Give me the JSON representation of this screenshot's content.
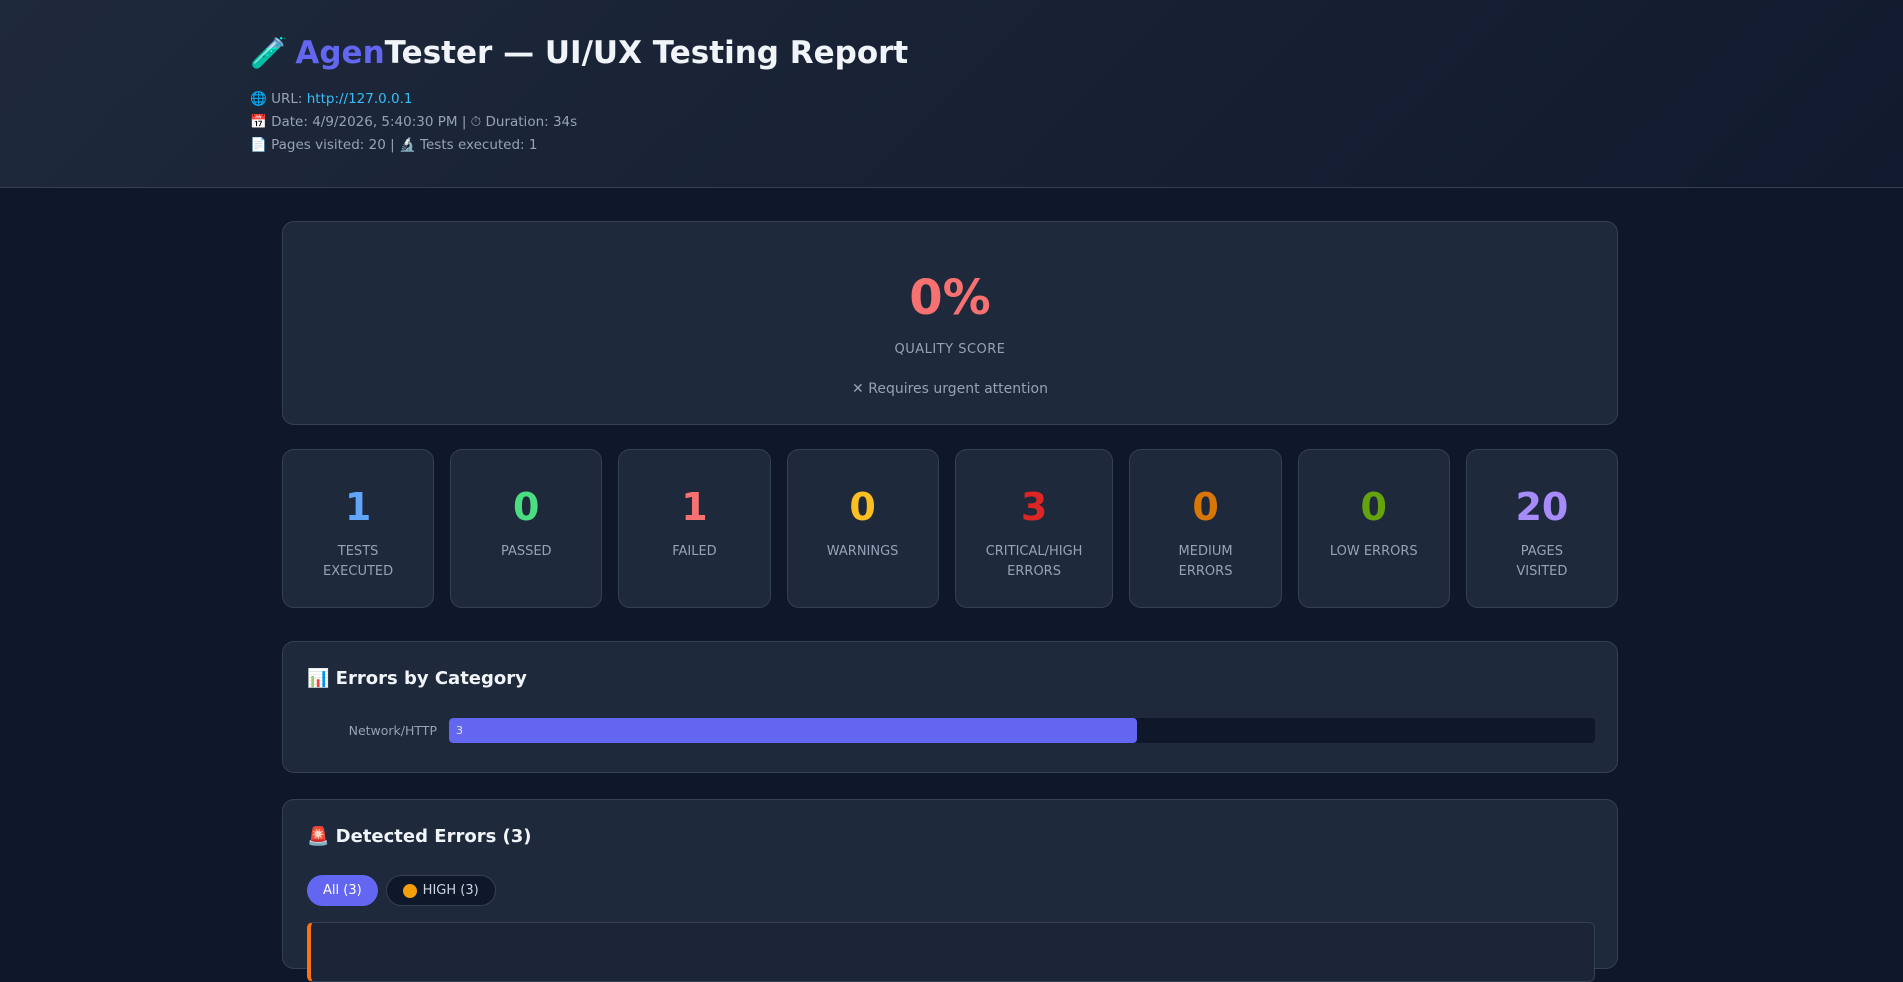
{
  "header": {
    "title_icon": "🧪",
    "title_accent": "Agen",
    "title_rest": "Tester — UI/UX Testing Report",
    "url_prefix": "🌐 URL: ",
    "url": "http://127.0.0.1",
    "date_line": "📅 Date: 4/9/2026, 5:40:30 PM | ⏱ Duration: 34s",
    "pages_line": "📄 Pages visited: 20 | 🔬 Tests executed: 1"
  },
  "score": {
    "value": "0%",
    "label": "QUALITY SCORE",
    "note": "✕ Requires urgent attention"
  },
  "stats": [
    {
      "value": "1",
      "label": "Tests executed",
      "color": "#60a5fa"
    },
    {
      "value": "0",
      "label": "Passed",
      "color": "#4ade80"
    },
    {
      "value": "1",
      "label": "Failed",
      "color": "#f87171"
    },
    {
      "value": "0",
      "label": "Warnings",
      "color": "#fbbf24"
    },
    {
      "value": "3",
      "label": "Critical/High errors",
      "color": "#dc2626"
    },
    {
      "value": "0",
      "label": "Medium errors",
      "color": "#d97706"
    },
    {
      "value": "0",
      "label": "Low errors",
      "color": "#65a30d"
    },
    {
      "value": "20",
      "label": "Pages visited",
      "color": "#a78bfa"
    }
  ],
  "categories": {
    "title": "📊 Errors by Category",
    "items": [
      {
        "label": "Network/HTTP",
        "value": "3",
        "fraction": 0.6
      }
    ]
  },
  "errors": {
    "title": "🚨 Detected Errors (3)",
    "filters": [
      {
        "label": "All (3)"
      },
      {
        "label": "HIGH (3)"
      }
    ]
  }
}
